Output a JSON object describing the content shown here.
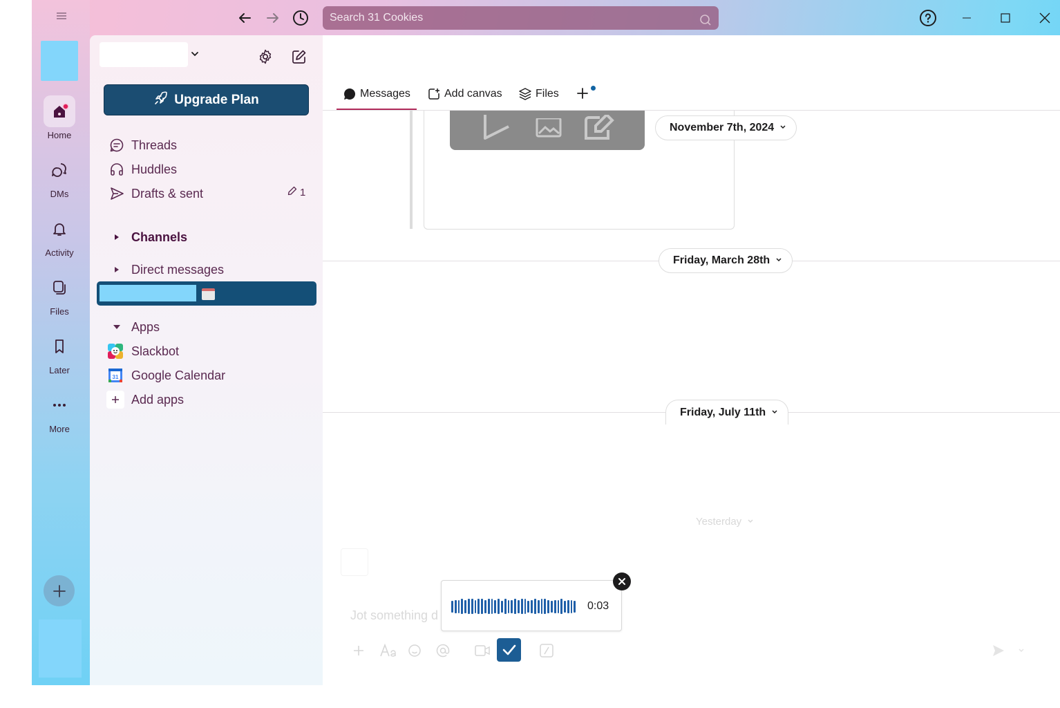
{
  "titlebar": {
    "search_placeholder": "Search 31 Cookies"
  },
  "rail": {
    "items": [
      {
        "label": "Home",
        "icon": "home-icon"
      },
      {
        "label": "DMs",
        "icon": "dm-icon"
      },
      {
        "label": "Activity",
        "icon": "bell-icon"
      },
      {
        "label": "Files",
        "icon": "files-icon"
      },
      {
        "label": "Later",
        "icon": "bookmark-icon"
      },
      {
        "label": "More",
        "icon": "more-icon"
      }
    ]
  },
  "sidebar": {
    "upgrade_label": "Upgrade Plan",
    "threads": "Threads",
    "huddles": "Huddles",
    "drafts": "Drafts & sent",
    "drafts_count": "1",
    "channels": "Channels",
    "direct_messages": "Direct messages",
    "apps": "Apps",
    "slackbot": "Slackbot",
    "google_calendar": "Google Calendar",
    "google_calendar_icon_text": "31",
    "add_apps": "Add apps"
  },
  "tabs": [
    {
      "label": "Messages",
      "active": true
    },
    {
      "label": "Add canvas",
      "active": false
    },
    {
      "label": "Files",
      "active": false
    }
  ],
  "dates": {
    "d1": "November 7th, 2024",
    "d2": "Friday, March 28th",
    "d3": "Friday, July 11th",
    "d4": "Yesterday"
  },
  "composer": {
    "placeholder": "Jot something d"
  },
  "audio": {
    "duration": "0:03",
    "waveform_levels": [
      0.7,
      0.8,
      0.8,
      0.9,
      0.8,
      0.9,
      0.9,
      0.8,
      0.9,
      0.9,
      0.8,
      0.9,
      0.9,
      0.8,
      0.9,
      0.7,
      0.9,
      0.8,
      0.8,
      0.9,
      0.8,
      0.9,
      0.9,
      0.7,
      0.8,
      0.9,
      0.8,
      0.9,
      0.9,
      0.8,
      0.7,
      0.8,
      0.8,
      0.9,
      0.7,
      0.8,
      0.8,
      0.7
    ]
  },
  "colors": {
    "accent": "#1b4d72",
    "selected_row": "#144f77",
    "text_primary": "#4a1240",
    "waveform": "#1f5fa8",
    "notification": "#e01e5a"
  }
}
